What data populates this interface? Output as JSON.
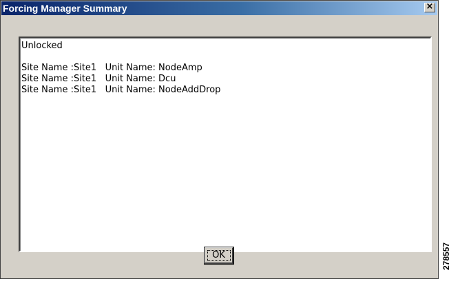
{
  "dialog": {
    "title": "Forcing Manager Summary",
    "close_label": "×"
  },
  "summary": {
    "status": "Unlocked",
    "entries": [
      "Site Name :Site1   Unit Name: NodeAmp",
      "Site Name :Site1   Unit Name: Dcu",
      "Site Name :Site1   Unit Name: NodeAddDrop"
    ]
  },
  "buttons": {
    "ok_label": "OK"
  },
  "side_figure_number": "278557"
}
